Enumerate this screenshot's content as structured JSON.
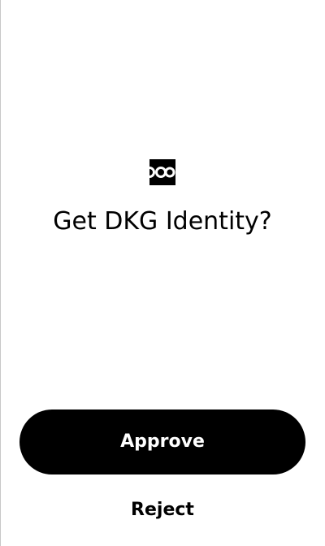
{
  "logo": {
    "icon": "app-logo-icon",
    "color": "#000000"
  },
  "prompt": {
    "title": "Get DKG Identity?"
  },
  "actions": {
    "approve_label": "Approve",
    "reject_label": "Reject",
    "approve_color": "#000000",
    "approve_text_color": "#ffffff"
  }
}
